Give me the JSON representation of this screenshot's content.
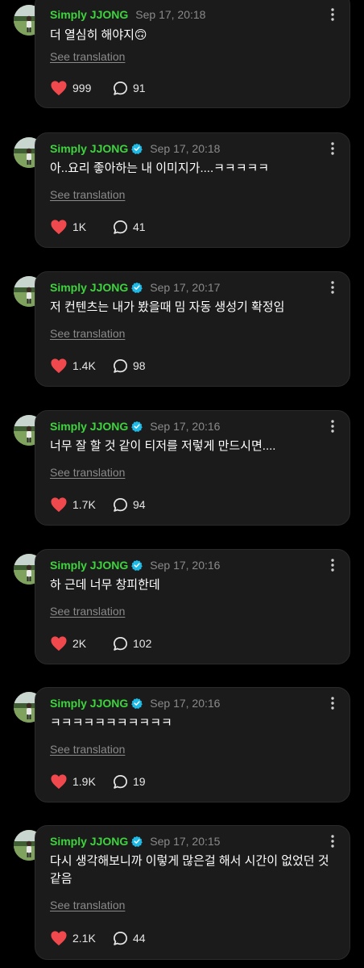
{
  "colors": {
    "background": "#000000",
    "card": "#1b1b1b",
    "username": "#3dd43d",
    "verified": "#1fb9e6",
    "heart": "#f0494d",
    "muted": "#8a8a8a"
  },
  "icons": {
    "like": "heart-icon",
    "comment": "comment-bubble-icon",
    "more": "more-vertical-icon",
    "verified": "verified-badge-icon"
  },
  "feed": {
    "posts": [
      {
        "username": "Simply JJONG",
        "verified": false,
        "timestamp": "Sep 17, 20:18",
        "text": "더 열심히 해야지🙃",
        "translate_label": "See translation",
        "likes": "999",
        "comments": "91"
      },
      {
        "username": "Simply JJONG",
        "verified": true,
        "timestamp": "Sep 17, 20:18",
        "text": "아..요리 좋아하는 내 이미지가....ㅋㅋㅋㅋㅋ",
        "translate_label": "See translation",
        "likes": "1K",
        "comments": "41"
      },
      {
        "username": "Simply JJONG",
        "verified": true,
        "timestamp": "Sep 17, 20:17",
        "text": "저 컨텐츠는 내가 봤을때 밈 자동 생성기 확정임",
        "translate_label": "See translation",
        "likes": "1.4K",
        "comments": "98"
      },
      {
        "username": "Simply JJONG",
        "verified": true,
        "timestamp": "Sep 17, 20:16",
        "text": "너무 잘 할 것 같이 티저를 저렇게 만드시면....",
        "translate_label": "See translation",
        "likes": "1.7K",
        "comments": "94"
      },
      {
        "username": "Simply JJONG",
        "verified": true,
        "timestamp": "Sep 17, 20:16",
        "text": "하 근데 너무 창피한데",
        "translate_label": "See translation",
        "likes": "2K",
        "comments": "102"
      },
      {
        "username": "Simply JJONG",
        "verified": true,
        "timestamp": "Sep 17, 20:16",
        "text": "ㅋㅋㅋㅋㅋㅋㅋㅋㅋㅋㅋ",
        "translate_label": "See translation",
        "likes": "1.9K",
        "comments": "19"
      },
      {
        "username": "Simply JJONG",
        "verified": true,
        "timestamp": "Sep 17, 20:15",
        "text": "다시 생각해보니까 이렇게 많은걸 해서 시간이 없었던 것 같음",
        "translate_label": "See translation",
        "likes": "2.1K",
        "comments": "44"
      }
    ]
  }
}
